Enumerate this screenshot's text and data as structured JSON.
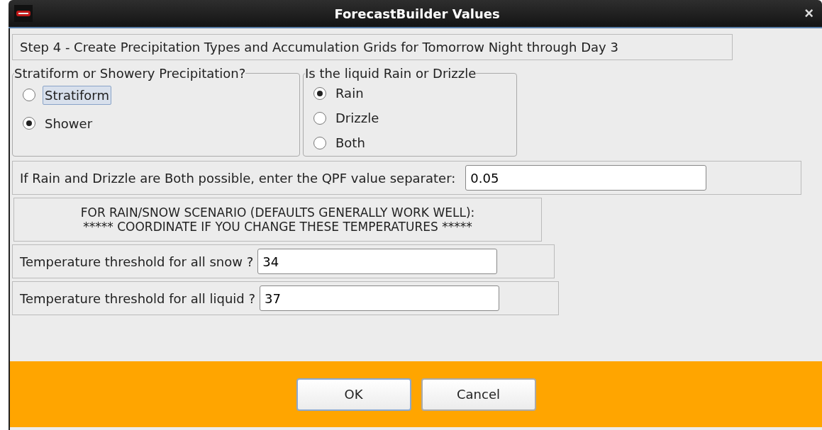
{
  "window": {
    "title": "ForecastBuilder Values",
    "close": "×"
  },
  "step_label": "Step 4 - Create Precipitation Types and Accumulation Grids for Tomorrow Night through Day 3",
  "groups": [
    {
      "title": "Stratiform or Showery Precipitation?",
      "options": [
        {
          "label": "Stratiform",
          "selected": false,
          "focused": true
        },
        {
          "label": "Shower",
          "selected": true,
          "focused": false
        }
      ]
    },
    {
      "title": "Is the liquid Rain or Drizzle",
      "options": [
        {
          "label": "Rain",
          "selected": true,
          "focused": false
        },
        {
          "label": "Drizzle",
          "selected": false,
          "focused": false
        },
        {
          "label": "Both",
          "selected": false,
          "focused": false
        }
      ]
    }
  ],
  "qpf": {
    "label": "If Rain and Drizzle are Both possible, enter the QPF value separater:",
    "value": "0.05"
  },
  "notice": [
    "FOR RAIN/SNOW SCENARIO (DEFAULTS GENERALLY WORK WELL):",
    "***** COORDINATE IF YOU CHANGE THESE TEMPERATURES *****"
  ],
  "thresholds": [
    {
      "label": "Temperature threshold for all snow ?",
      "value": "34"
    },
    {
      "label": "Temperature threshold for all liquid ?",
      "value": "37"
    }
  ],
  "buttons": [
    {
      "label": "OK",
      "default": true
    },
    {
      "label": "Cancel",
      "default": false
    }
  ]
}
